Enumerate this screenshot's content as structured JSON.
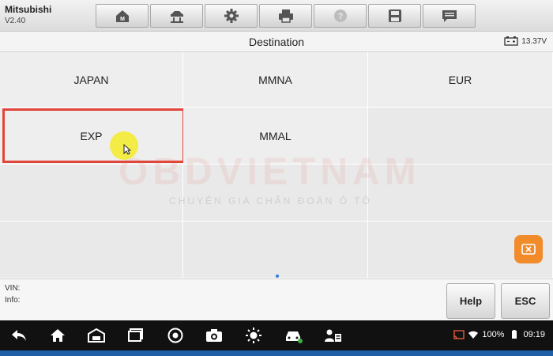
{
  "app": {
    "name": "Mitsubishi",
    "version": "V2.40"
  },
  "toolbar": {
    "items": [
      {
        "icon": "home-icon"
      },
      {
        "icon": "vehicle-lift-icon"
      },
      {
        "icon": "gear-icon"
      },
      {
        "icon": "printer-icon"
      },
      {
        "icon": "help-circle-icon"
      },
      {
        "icon": "save-icon"
      },
      {
        "icon": "message-icon"
      }
    ]
  },
  "header": {
    "title": "Destination",
    "battery_voltage": "13.37V"
  },
  "grid": {
    "cells": [
      {
        "label": "JAPAN"
      },
      {
        "label": "MMNA"
      },
      {
        "label": "EUR"
      },
      {
        "label": "EXP",
        "highlighted": true
      },
      {
        "label": "MMAL"
      },
      {
        "label": ""
      },
      {
        "label": ""
      },
      {
        "label": ""
      },
      {
        "label": ""
      },
      {
        "label": ""
      },
      {
        "label": ""
      },
      {
        "label": ""
      }
    ]
  },
  "watermark": {
    "main": "OBDVIETNAM",
    "sub": "CHUYÊN GIA CHẨN ĐOÁN Ô TÔ"
  },
  "info": {
    "vin_label": "VIN:",
    "info_label": "Info:"
  },
  "buttons": {
    "help": "Help",
    "esc": "ESC"
  },
  "android": {
    "battery": "100%",
    "time": "09:19",
    "nav_icons": [
      "back-icon",
      "home-icon",
      "garage-icon",
      "recents-icon",
      "chrome-icon",
      "camera-icon",
      "brightness-icon",
      "car-connect-icon",
      "user-switch-icon"
    ]
  },
  "colors": {
    "highlight": "#e0463b",
    "accent": "#f28b2a",
    "cursor": "#f5eb28"
  }
}
